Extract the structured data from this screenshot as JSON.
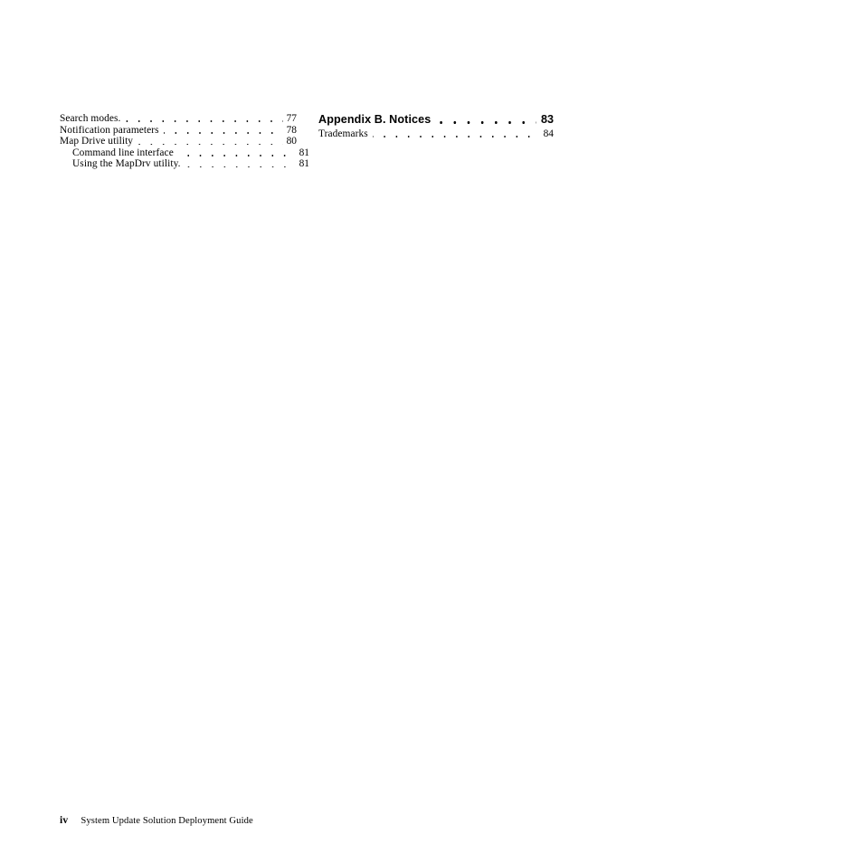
{
  "document": {
    "type": "table-of-contents",
    "footer": {
      "folio": "iv",
      "title": "System Update Solution Deployment Guide"
    }
  },
  "toc": {
    "left_column": {
      "entries": [
        {
          "title": "Search modes.",
          "page": "77",
          "level": 1,
          "style": "normal"
        },
        {
          "title": "Notification parameters",
          "page": "78",
          "level": 1,
          "style": "normal"
        },
        {
          "title": "Map Drive utility",
          "page": "80",
          "level": 1,
          "style": "normal"
        },
        {
          "title": "Command line interface",
          "page": "81",
          "level": 2,
          "style": "normal"
        },
        {
          "title": "Using the MapDrv utility.",
          "page": "81",
          "level": 2,
          "style": "normal"
        }
      ]
    },
    "right_column": {
      "entries": [
        {
          "title": "Appendix B. Notices",
          "page": "83",
          "level": 1,
          "style": "heading"
        },
        {
          "title": "Trademarks",
          "page": "84",
          "level": 1,
          "style": "normal"
        }
      ]
    }
  }
}
